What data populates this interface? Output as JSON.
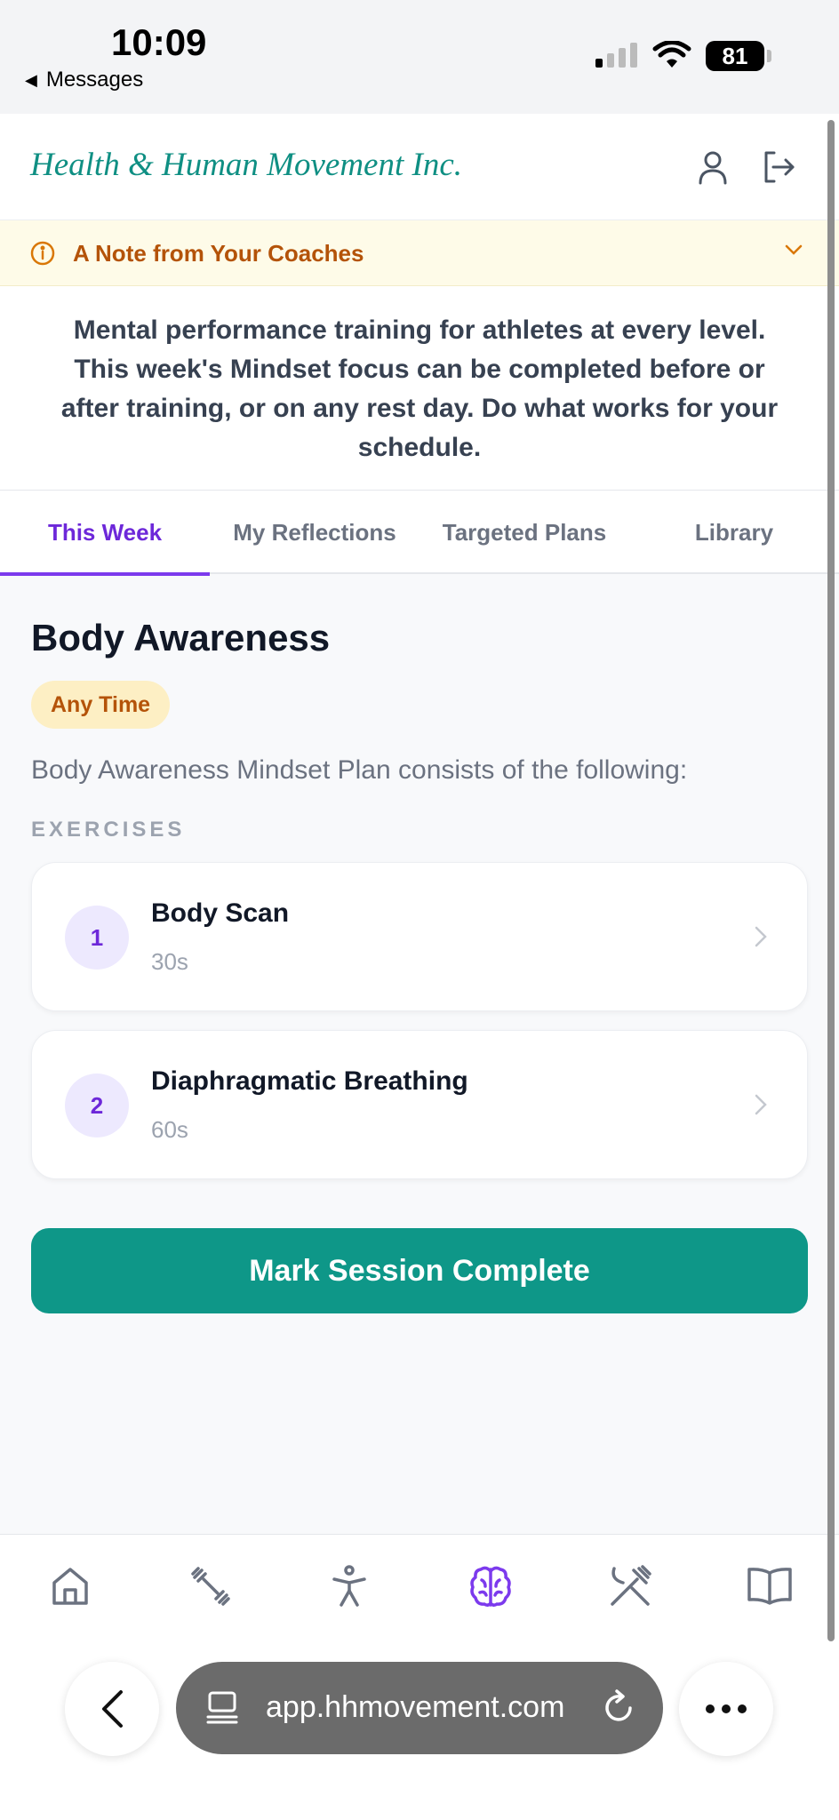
{
  "status_bar": {
    "time": "10:09",
    "back_label": "Messages",
    "battery": "81"
  },
  "header": {
    "brand": "Health & Human Movement Inc.",
    "icons": [
      "user-icon",
      "logout-icon"
    ]
  },
  "note": {
    "title": "A Note from Your Coaches",
    "body": "Mental performance training for athletes at every level. This week's Mindset focus can be completed before or after training, or on any rest day. Do what works for your schedule."
  },
  "tabs": [
    {
      "label": "This Week",
      "active": true
    },
    {
      "label": "My Reflections",
      "active": false
    },
    {
      "label": "Targeted Plans",
      "active": false
    },
    {
      "label": "Library",
      "active": false
    }
  ],
  "plan": {
    "title": "Body Awareness",
    "badge": "Any Time",
    "description": "Body Awareness Mindset Plan consists of the following:",
    "section_label": "EXERCISES",
    "exercises": [
      {
        "number": "1",
        "name": "Body Scan",
        "duration": "30s"
      },
      {
        "number": "2",
        "name": "Diaphragmatic Breathing",
        "duration": "60s"
      }
    ],
    "complete_button": "Mark Session Complete"
  },
  "bottom_nav": [
    {
      "icon": "home-icon",
      "active": false
    },
    {
      "icon": "dumbbell-icon",
      "active": false
    },
    {
      "icon": "person-icon",
      "active": false
    },
    {
      "icon": "brain-icon",
      "active": true
    },
    {
      "icon": "utensils-icon",
      "active": false
    },
    {
      "icon": "book-icon",
      "active": false
    }
  ],
  "browser": {
    "url": "app.hhmovement.com"
  },
  "colors": {
    "brand": "#0f8f83",
    "accent": "#7c3aed",
    "primary_button": "#0e9788",
    "note_text": "#b45309"
  }
}
